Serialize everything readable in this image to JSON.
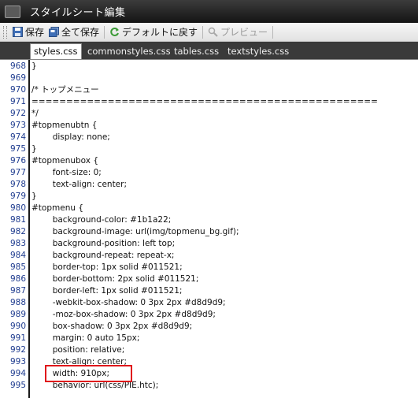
{
  "window": {
    "title": "スタイルシート編集",
    "app_icon": "app-icon"
  },
  "toolbar": {
    "save_label": "保存",
    "save_all_label": "全て保存",
    "restore_default_label": "デフォルトに戻す",
    "preview_label": "プレビュー"
  },
  "tabs": [
    {
      "label": "styles.css",
      "active": true
    },
    {
      "label": "commonstyles.css",
      "active": false
    },
    {
      "label": "tables.css",
      "active": false
    },
    {
      "label": "textstyles.css",
      "active": false
    }
  ],
  "editor": {
    "lines": [
      {
        "num": "968",
        "text": "}"
      },
      {
        "num": "969",
        "text": ""
      },
      {
        "num": "970",
        "text": "/* トップメニュー"
      },
      {
        "num": "971",
        "text": "=================================================="
      },
      {
        "num": "972",
        "text": "*/"
      },
      {
        "num": "973",
        "text": "#topmenubtn {"
      },
      {
        "num": "974",
        "text": "\tdisplay: none;"
      },
      {
        "num": "975",
        "text": "}"
      },
      {
        "num": "976",
        "text": "#topmenubox {"
      },
      {
        "num": "977",
        "text": "\tfont-size: 0;"
      },
      {
        "num": "978",
        "text": "\ttext-align: center;"
      },
      {
        "num": "979",
        "text": "}"
      },
      {
        "num": "980",
        "text": "#topmenu {"
      },
      {
        "num": "981",
        "text": "\tbackground-color: #1b1a22;"
      },
      {
        "num": "982",
        "text": "\tbackground-image: url(img/topmenu_bg.gif);"
      },
      {
        "num": "983",
        "text": "\tbackground-position: left top;"
      },
      {
        "num": "984",
        "text": "\tbackground-repeat: repeat-x;"
      },
      {
        "num": "985",
        "text": "\tborder-top: 1px solid #011521;"
      },
      {
        "num": "986",
        "text": "\tborder-bottom: 2px solid #011521;"
      },
      {
        "num": "987",
        "text": "\tborder-left: 1px solid #011521;"
      },
      {
        "num": "988",
        "text": "\t-webkit-box-shadow: 0 3px 2px #d8d9d9;"
      },
      {
        "num": "989",
        "text": "\t-moz-box-shadow: 0 3px 2px #d8d9d9;"
      },
      {
        "num": "990",
        "text": "\tbox-shadow: 0 3px 2px #d8d9d9;"
      },
      {
        "num": "991",
        "text": "\tmargin: 0 auto 15px;"
      },
      {
        "num": "992",
        "text": "\tposition: relative;"
      },
      {
        "num": "993",
        "text": "\ttext-align: center;"
      },
      {
        "num": "994",
        "text": "\twidth: 910px;"
      },
      {
        "num": "995",
        "text": "\tbehavior: url(css/PIE.htc);"
      }
    ],
    "highlighted_line": "994",
    "highlight_color": "#e0161b"
  }
}
